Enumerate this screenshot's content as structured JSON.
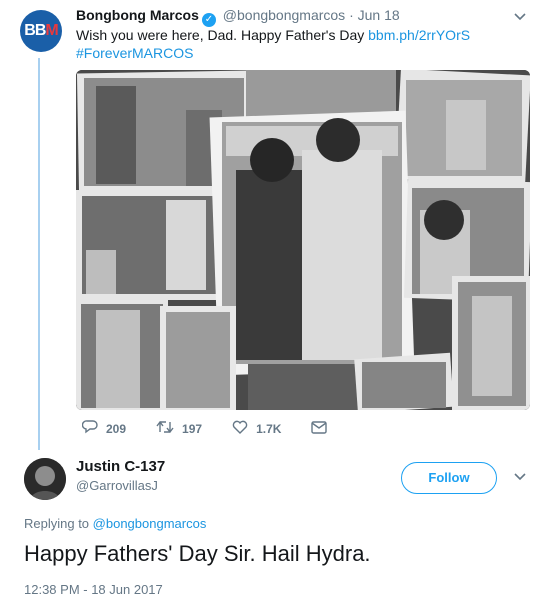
{
  "tweet": {
    "author_name": "Bongbong Marcos",
    "handle": "@bongbongmarcos",
    "date": "Jun 18",
    "separator": "·",
    "text": "Wish you were here, Dad. Happy Father's Day",
    "link": "bbm.ph/2rrYOrS",
    "hashtag": "#ForeverMARCOS",
    "avatar_text": "BB",
    "avatar_accent": "M",
    "replies": "209",
    "retweets": "197",
    "likes": "1.7K",
    "icons": {
      "reply": "comment-icon",
      "retweet": "retweet-icon",
      "like": "heart-icon",
      "dm": "envelope-icon",
      "menu": "chevron-down-icon"
    }
  },
  "reply": {
    "author_name": "Justin C-137",
    "handle": "@GarrovillasJ",
    "follow_label": "Follow",
    "replying_prefix": "Replying to",
    "replying_to": "@bongbongmarcos",
    "text": "Happy Fathers' Day Sir. Hail Hydra.",
    "timestamp": "12:38 PM - 18 Jun 2017"
  },
  "colors": {
    "link": "#1b95e0",
    "muted": "#657786",
    "thread_line": "#a8d0f0",
    "follow": "#1da1f2"
  }
}
